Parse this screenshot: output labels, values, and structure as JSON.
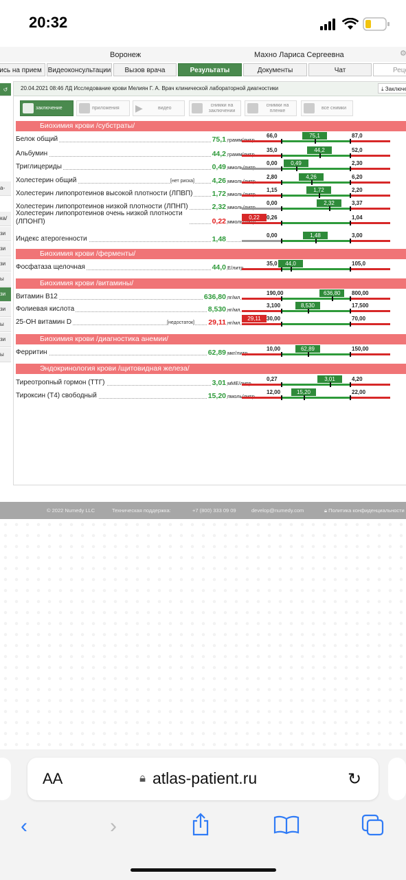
{
  "status": {
    "time": "20:32"
  },
  "top": {
    "city": "Воронеж",
    "patient": "Махно Лариса Сергеевна"
  },
  "tabs": [
    {
      "label": "ись на прием"
    },
    {
      "label": "Видеоконсультации"
    },
    {
      "label": "Вызов врача"
    },
    {
      "label": "Результаты",
      "active": true
    },
    {
      "label": "Документы"
    },
    {
      "label": "Чат"
    },
    {
      "label": "Рецеп"
    }
  ],
  "leftstrip": [
    "а-",
    "ка/",
    "зи",
    "зи",
    "зи",
    "ы",
    "зи",
    "зи",
    "ы",
    "зи",
    "ы"
  ],
  "card": {
    "header": "20.04.2021 08:46 ЛД Исследование крови Мелиян Г. А. Врач клинической лабораторной диагностики",
    "download": "Заключе",
    "toolbar": [
      {
        "label": "заключение",
        "active": true
      },
      {
        "label": "приложения"
      },
      {
        "label": "видео"
      },
      {
        "label": "снимки на заключении"
      },
      {
        "label": "снимки на пленке"
      },
      {
        "label": "все снимки"
      }
    ]
  },
  "sections": [
    {
      "title": "Биохимия крови /субстраты/",
      "rows": [
        {
          "name": "Белок общий",
          "value": "75,1",
          "unit": "грамм/литр",
          "low": "66,0",
          "high": "87,0",
          "status": "normal",
          "pos": 0.48
        },
        {
          "name": "Альбумин",
          "value": "44,2",
          "unit": "грамм/литр",
          "low": "35,0",
          "high": "52,0",
          "status": "normal",
          "pos": 0.55
        },
        {
          "name": "Триглицериды",
          "value": "0,49",
          "unit": "ммоль/литр",
          "low": "0,00",
          "high": "2,30",
          "status": "normal",
          "pos": 0.21
        },
        {
          "name": "Холестерин общий",
          "note": "[нет риска]",
          "value": "4,26",
          "unit": "ммоль/литр",
          "low": "2,80",
          "high": "6,20",
          "status": "normal",
          "pos": 0.43
        },
        {
          "name": "Холестерин липопротеинов высокой плотности (ЛПВП)",
          "value": "1,72",
          "unit": "ммоль/литр",
          "low": "1,15",
          "high": "2,20",
          "status": "normal",
          "pos": 0.54
        },
        {
          "name": "Холестерин липопротеинов низкой плотности (ЛПНП)",
          "value": "2,32",
          "unit": "ммоль/литр",
          "low": "0,00",
          "high": "3,37",
          "status": "normal",
          "pos": 0.69
        },
        {
          "name": "Холестерин липопротеинов очень низкой плотности (ЛПОНП)",
          "value": "0,22",
          "unit": "ммоль/литр",
          "low": "0,26",
          "high": "1,04",
          "status": "low"
        },
        {
          "name": "Индекс атерогенности",
          "value": "1,48",
          "unit": "",
          "low": "0,00",
          "high": "3,00",
          "status": "normal",
          "pos": 0.49
        }
      ]
    },
    {
      "title": "Биохимия крови /ферменты/",
      "rows": [
        {
          "name": "Фосфатаза щелочная",
          "value": "44,0",
          "unit": "Е/литр",
          "low": "35,0",
          "high": "105,0",
          "status": "normal",
          "pos": 0.13
        }
      ]
    },
    {
      "title": "Биохимия крови /витамины/",
      "rows": [
        {
          "name": "Витамин В12",
          "value": "636,80",
          "unit": "пг/мл",
          "low": "190,00",
          "high": "800,00",
          "status": "normal",
          "pos": 0.73
        },
        {
          "name": "Фолиевая кислота",
          "value": "8,530",
          "unit": "нг/мл",
          "low": "3,100",
          "high": "17,500",
          "status": "normal",
          "pos": 0.38
        },
        {
          "name": "25-OH витамин D",
          "note": "[недостаток]",
          "value": "29,11",
          "unit": "нг/мл",
          "low": "30,00",
          "high": "70,00",
          "status": "low"
        }
      ]
    },
    {
      "title": "Биохимия крови /диагностика анемии/",
      "rows": [
        {
          "name": "Ферритин",
          "value": "62,89",
          "unit": "мкг/литр",
          "low": "10,00",
          "high": "150,00",
          "status": "normal",
          "pos": 0.38
        }
      ]
    },
    {
      "title": "Эндокринология крови /щитовидная железа/",
      "rows": [
        {
          "name": "Тиреотропный гормон (ТТГ)",
          "value": "3,01",
          "unit": "мМЕ/литр",
          "low": "0,27",
          "high": "4,20",
          "status": "normal",
          "pos": 0.7
        },
        {
          "name": "Тироксин (Т4) свободный",
          "value": "15,20",
          "unit": "пмоль/литр",
          "low": "12,00",
          "high": "22,00",
          "status": "normal",
          "pos": 0.32
        }
      ]
    }
  ],
  "footer": {
    "copyright": "© 2022 Numedy LLC",
    "support": "Техническая поддержка:",
    "phone": "+7 (800) 333 09 09",
    "email": "develop@numedy.com",
    "privacy": "Политика конфиденциальности"
  },
  "browser": {
    "aa": "AA",
    "url": "atlas-patient.ru"
  }
}
